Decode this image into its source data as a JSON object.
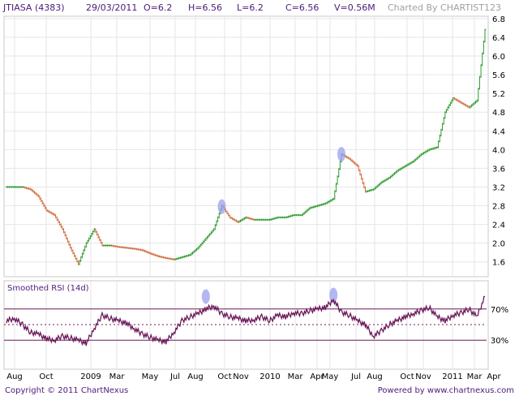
{
  "header": {
    "symbol": "JTIASA (4383)",
    "date": "29/03/2011",
    "open": "O=6.2",
    "high": "H=6.56",
    "low": "L=6.2",
    "close": "C=6.56",
    "volume": "V=0.56M",
    "charted_by": "Charted By CHARTIST123"
  },
  "footer": {
    "copyright": "Copyright © 2011 ChartNexus",
    "powered_by": "Powered by www.chartnexus.com"
  },
  "colors": {
    "up": "#2e9a2e",
    "down": "#d06a3a",
    "rsi_line": "#6b1a5a",
    "rsi_band": "#6b1a5a",
    "grid": "#e6e6e6",
    "highlight": "#9aa0f0",
    "text": "#4b1a7a"
  },
  "chart_data": [
    {
      "type": "line",
      "title": "",
      "series": [
        {
          "values": [
            3.2,
            3.2,
            3.2,
            3.15,
            3.0,
            2.7,
            2.6,
            2.3,
            1.9,
            1.55,
            2.0,
            2.3,
            1.95,
            1.95,
            1.92,
            1.9,
            1.88,
            1.85,
            1.78,
            1.72,
            1.68,
            1.65,
            1.7,
            1.75,
            1.9,
            2.1,
            2.3,
            2.8,
            2.55,
            2.45,
            2.55,
            2.5,
            2.5,
            2.5,
            2.55,
            2.55,
            2.6,
            2.6,
            2.75,
            2.8,
            2.85,
            2.95,
            3.9,
            3.8,
            3.65,
            3.1,
            3.15,
            3.3,
            3.4,
            3.55,
            3.65,
            3.75,
            3.9,
            4.0,
            4.05,
            4.8,
            5.1,
            5.0,
            4.9,
            5.05,
            6.56
          ]
        }
      ],
      "y_ticks": [
        "1.6",
        "2.0",
        "2.4",
        "2.8",
        "3.2",
        "3.6",
        "4.0",
        "4.4",
        "4.8",
        "5.2",
        "5.6",
        "6.0",
        "6.4",
        "6.8"
      ],
      "ylim": [
        1.3,
        6.85
      ],
      "x_ticks": [
        "Aug",
        "Oct",
        "2009",
        "Mar",
        "May",
        "Jul",
        "Aug",
        "Oct",
        "Nov",
        "2010",
        "Mar",
        "Apr",
        "May",
        "Jul",
        "Aug",
        "Oct",
        "Nov",
        "2011",
        "Mar",
        "Apr"
      ],
      "grid": true
    },
    {
      "type": "line",
      "title": "Smoothed RSI (14d)",
      "series": [
        {
          "values": [
            55,
            58,
            50,
            40,
            38,
            32,
            30,
            35,
            33,
            30,
            26,
            45,
            62,
            58,
            55,
            52,
            45,
            38,
            34,
            30,
            28,
            40,
            55,
            60,
            64,
            70,
            74,
            64,
            60,
            58,
            55,
            56,
            60,
            55,
            62,
            60,
            65,
            64,
            68,
            70,
            72,
            82,
            66,
            62,
            55,
            50,
            35,
            42,
            50,
            55,
            60,
            64,
            68,
            72,
            60,
            55,
            62,
            65,
            70,
            60,
            86
          ]
        }
      ],
      "y_ticks": [
        "70%",
        "30%"
      ],
      "ylim": [
        0,
        100
      ],
      "bands": [
        70,
        50,
        30
      ],
      "grid": false
    }
  ]
}
